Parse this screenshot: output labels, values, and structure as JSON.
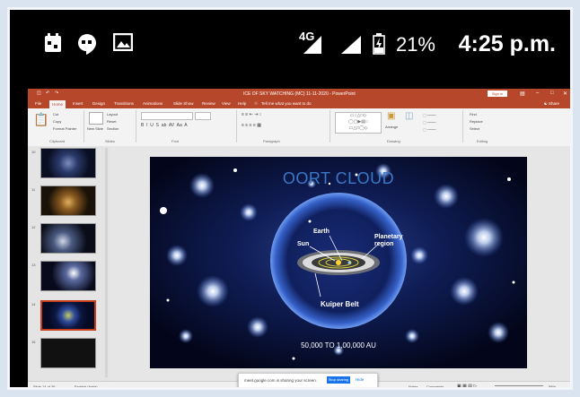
{
  "statusbar": {
    "network": "4G",
    "battery_percent": "21%",
    "time": "4:25 p.m."
  },
  "ppt": {
    "doc_title": "ICE OF SKY WATCHING (MC) 11-11-2020 - PowerPoint",
    "sign_in": "Sign in",
    "tabs": [
      "File",
      "Home",
      "Insert",
      "Design",
      "Transitions",
      "Animations",
      "Slide Show",
      "Review",
      "View",
      "Help"
    ],
    "tell_me": "Tell me what you want to do",
    "share": "Share",
    "ribbon": {
      "cut": "Cut",
      "copy": "Copy",
      "format_painter": "Format Painter",
      "new_slide": "New Slide",
      "layout": "Layout",
      "reset": "Reset",
      "section": "Section",
      "find": "Find",
      "replace": "Replace",
      "select": "Select",
      "arrange": "Arrange",
      "groups": [
        "Clipboard",
        "Slides",
        "Font",
        "Paragraph",
        "Drawing",
        "Editing"
      ]
    },
    "thumb_numbers": [
      "10",
      "11",
      "12",
      "13",
      "14",
      "15"
    ],
    "slide": {
      "title": "OORT CLOUD",
      "labels": {
        "earth": "Earth",
        "sun": "Sun",
        "planetary": "Planetary\nregion",
        "kuiper": "Kuiper Belt"
      },
      "distance": "50,000 TO 1,00,000 AU"
    },
    "statusbar": {
      "slide_info": "Slide 14 of 36",
      "language": "English (India)",
      "notes": "Notes",
      "comments": "Comments",
      "zoom": "58%"
    },
    "sharebar": {
      "message": "meet.google.com is sharing your screen.",
      "stop": "Stop sharing",
      "hide": "Hide"
    }
  },
  "colors": {
    "accent": "#b7472a",
    "share_blue": "#1a73e8",
    "title_blue": "#3a78c8"
  }
}
